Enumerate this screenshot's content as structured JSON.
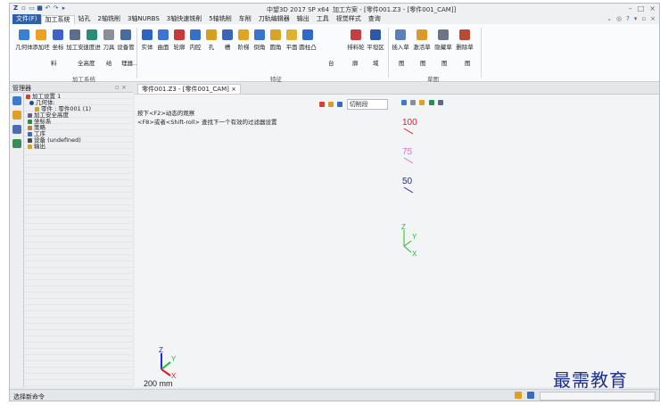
{
  "window": {
    "app_title": "中望3D 2017 SP x64",
    "doc_title": "加工方案 - [零件001.Z3 - [零件001_CAM]]"
  },
  "menu": {
    "file": "文件(F)",
    "items": [
      "加工系统",
      "钻孔",
      "2轴铣削",
      "3轴NURBS",
      "3轴快速铣削",
      "5轴铣削",
      "车削",
      "刀轨编辑器",
      "输出",
      "工具",
      "视觉样式",
      "查询"
    ]
  },
  "ribbon": {
    "group1": {
      "name": "加工系统",
      "buttons": [
        "几何体",
        "添加坯",
        "坐标",
        "加工安",
        "速度进",
        "刀具",
        "设备管"
      ],
      "sublabels": [
        "料",
        "全高度",
        "给",
        "理器.."
      ]
    },
    "group2": {
      "name": "特征",
      "buttons": [
        "实体",
        "曲面",
        "轮廓",
        "内腔",
        "孔",
        "槽",
        "阶梯",
        "倒角",
        "圆角",
        "平面",
        "圆柱凸",
        "排料轮",
        "平坦区"
      ],
      "sublabels": [
        "台",
        "廓",
        "域"
      ]
    },
    "group3": {
      "name": "草图",
      "buttons": [
        "插入草",
        "激活草",
        "隐藏草",
        "删除草"
      ],
      "sublabels": [
        "图",
        "图",
        "图",
        "图"
      ]
    }
  },
  "manager": {
    "title": "管理器",
    "tree": [
      "加工设置 1",
      "几何体:",
      "零件 : 零件001 (1)",
      "加工安全高度",
      "坐标系",
      "策略",
      "工序",
      "设备 (undefined)",
      "输出"
    ]
  },
  "document_tab": "零件001.Z3 - [零件001_CAM]",
  "viewport": {
    "hint1": "按下<F2>动态的观察",
    "hint2": "<F8>或者<Shift-roll> 查找下一个有效的过滤器设置",
    "filter_label": "切削段",
    "sample_labels": [
      "100",
      "75",
      "50"
    ],
    "axis_labels": {
      "z": "Z",
      "y": "Y",
      "x": "X"
    },
    "scale_text": "200 mm"
  },
  "status": {
    "message": "选择新命令"
  },
  "watermark": "最需教育",
  "colors": {
    "accent": "#2d5fa8",
    "label_100": "#e0182b",
    "label_75": "#e36ad6",
    "label_50": "#1c2aa8",
    "axis_x": "#e0182b",
    "axis_y": "#1fbf2b",
    "axis_z": "#1d2fd0"
  }
}
